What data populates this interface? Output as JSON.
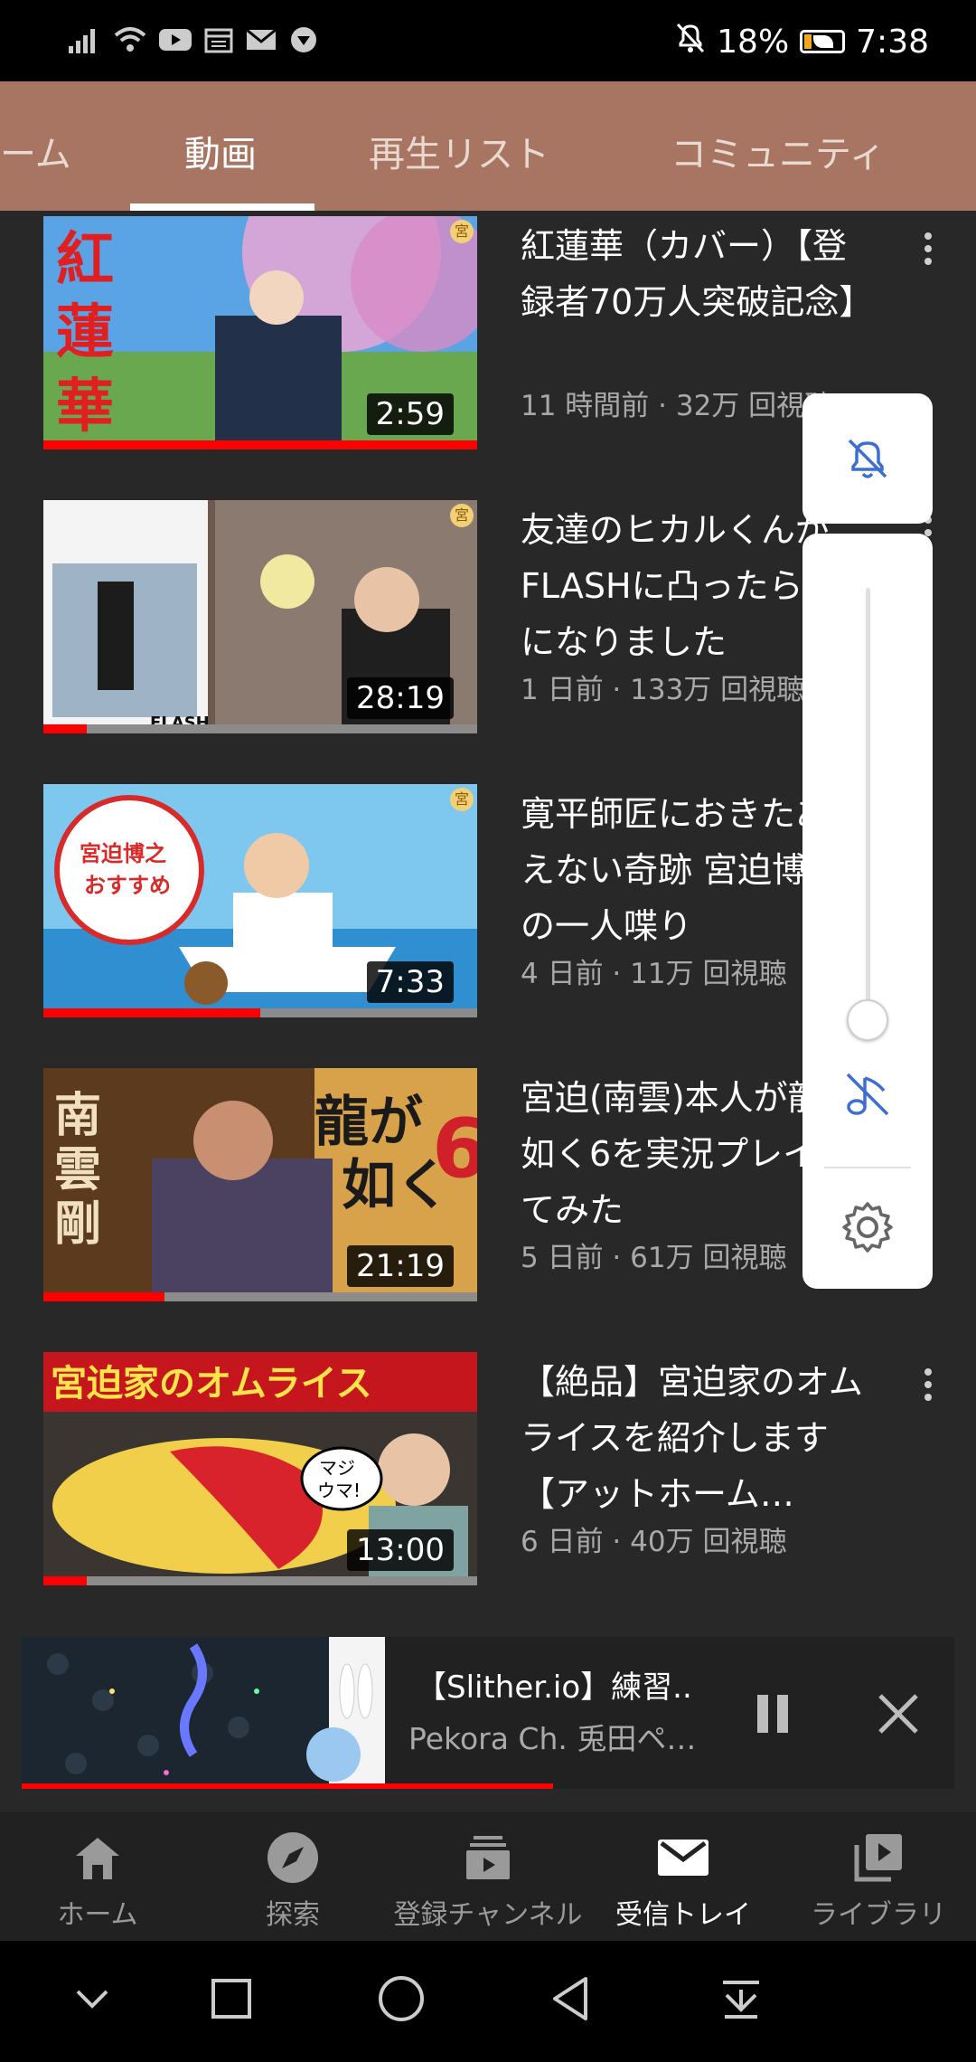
{
  "status": {
    "notification_icons": [
      "signal-icon",
      "wifi-icon",
      "youtube-icon",
      "calendar-icon",
      "mail-icon",
      "app-icon"
    ],
    "battery": "18%",
    "time": "7:38"
  },
  "tabs": [
    "ーム",
    "動画",
    "再生リスト",
    "コミュニティ"
  ],
  "active_tab": "動画",
  "videos": [
    {
      "title": "紅蓮華（カバー）【登録者70万人突破記念】",
      "meta": "11 時間前 · 32万 回視聴",
      "duration": "2:59",
      "progress": 1.0,
      "thumb_text": "紅蓮華"
    },
    {
      "title": "友達のヒカルくんがFLASHに凸ったら口論になりました",
      "meta": "1 日前 · 133万 回視聴",
      "duration": "28:19",
      "progress": 0.1,
      "thumb_text": "FLASH"
    },
    {
      "title": "寛平師匠におきたありえない奇跡 宮迫博之の一人喋り",
      "meta": "4 日前 · 11万 回視聴",
      "duration": "7:33",
      "progress": 0.5,
      "thumb_text": "宮迫博之おすすめ"
    },
    {
      "title": "宮迫(南雲)本人が龍が如く6を実況プレイしてみた",
      "meta": "5 日前 · 61万 回視聴",
      "duration": "21:19",
      "progress": 0.28,
      "thumb_text": "南雲剛"
    },
    {
      "title": "【絶品】宮迫家のオムライスを紹介します【アットホーム…",
      "meta": "6 日前 · 40万 回視聴",
      "duration": "13:00",
      "progress": 0.1,
      "thumb_text": "宮迫家のオムライス"
    }
  ],
  "volume": {
    "level": 0.05
  },
  "miniplayer": {
    "title": "【Slither.io】練習..",
    "channel": "Pekora Ch. 兎田ペ…",
    "progress": 0.57
  },
  "bottom_nav": [
    {
      "label": "ホーム",
      "icon": "home-icon"
    },
    {
      "label": "探索",
      "icon": "explore-icon"
    },
    {
      "label": "登録チャンネル",
      "icon": "subscriptions-icon"
    },
    {
      "label": "受信トレイ",
      "icon": "inbox-icon"
    },
    {
      "label": "ライブラリ",
      "icon": "library-icon"
    }
  ],
  "active_nav": "受信トレイ",
  "colors": {
    "accent_tab_bar": "#a87562",
    "progress_red": "#ff0000",
    "background": "#282828"
  }
}
